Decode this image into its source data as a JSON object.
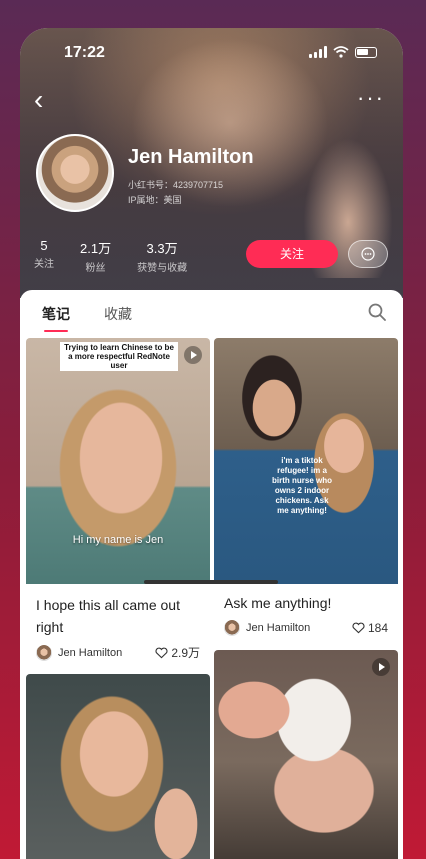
{
  "status_bar": {
    "time": "17:22"
  },
  "profile": {
    "name": "Jen Hamilton",
    "id_line": "小红书号：4239707715",
    "ip_line": "IP属地：美国",
    "stats": [
      {
        "value": "5",
        "label": "关注"
      },
      {
        "value": "2.1万",
        "label": "粉丝"
      },
      {
        "value": "3.3万",
        "label": "获赞与收藏"
      }
    ],
    "follow_label": "关注",
    "message_icon": "chat-bubble-icon"
  },
  "tabs": [
    {
      "label": "笔记",
      "active": true
    },
    {
      "label": "收藏",
      "active": false
    }
  ],
  "notes": [
    {
      "image_caption_top": "Trying to learn Chinese to be a more respectful RedNote user",
      "image_caption_mid": "Hi my name is Jen",
      "title": "I hope this all came out right",
      "author": "Jen Hamilton",
      "likes": "2.9万",
      "is_video": true
    },
    {
      "image_shirt_text": "i'm a tiktok refugee! im a birth nurse who owns 2 indoor chickens. Ask me anything!",
      "title": "Ask me anything!",
      "author": "Jen Hamilton",
      "likes": "184",
      "is_video": false
    },
    {
      "title": "",
      "author": "",
      "likes": "",
      "is_video": false
    },
    {
      "title": "",
      "author": "",
      "likes": "",
      "is_video": true
    }
  ],
  "colors": {
    "accent": "#ff2c55"
  }
}
